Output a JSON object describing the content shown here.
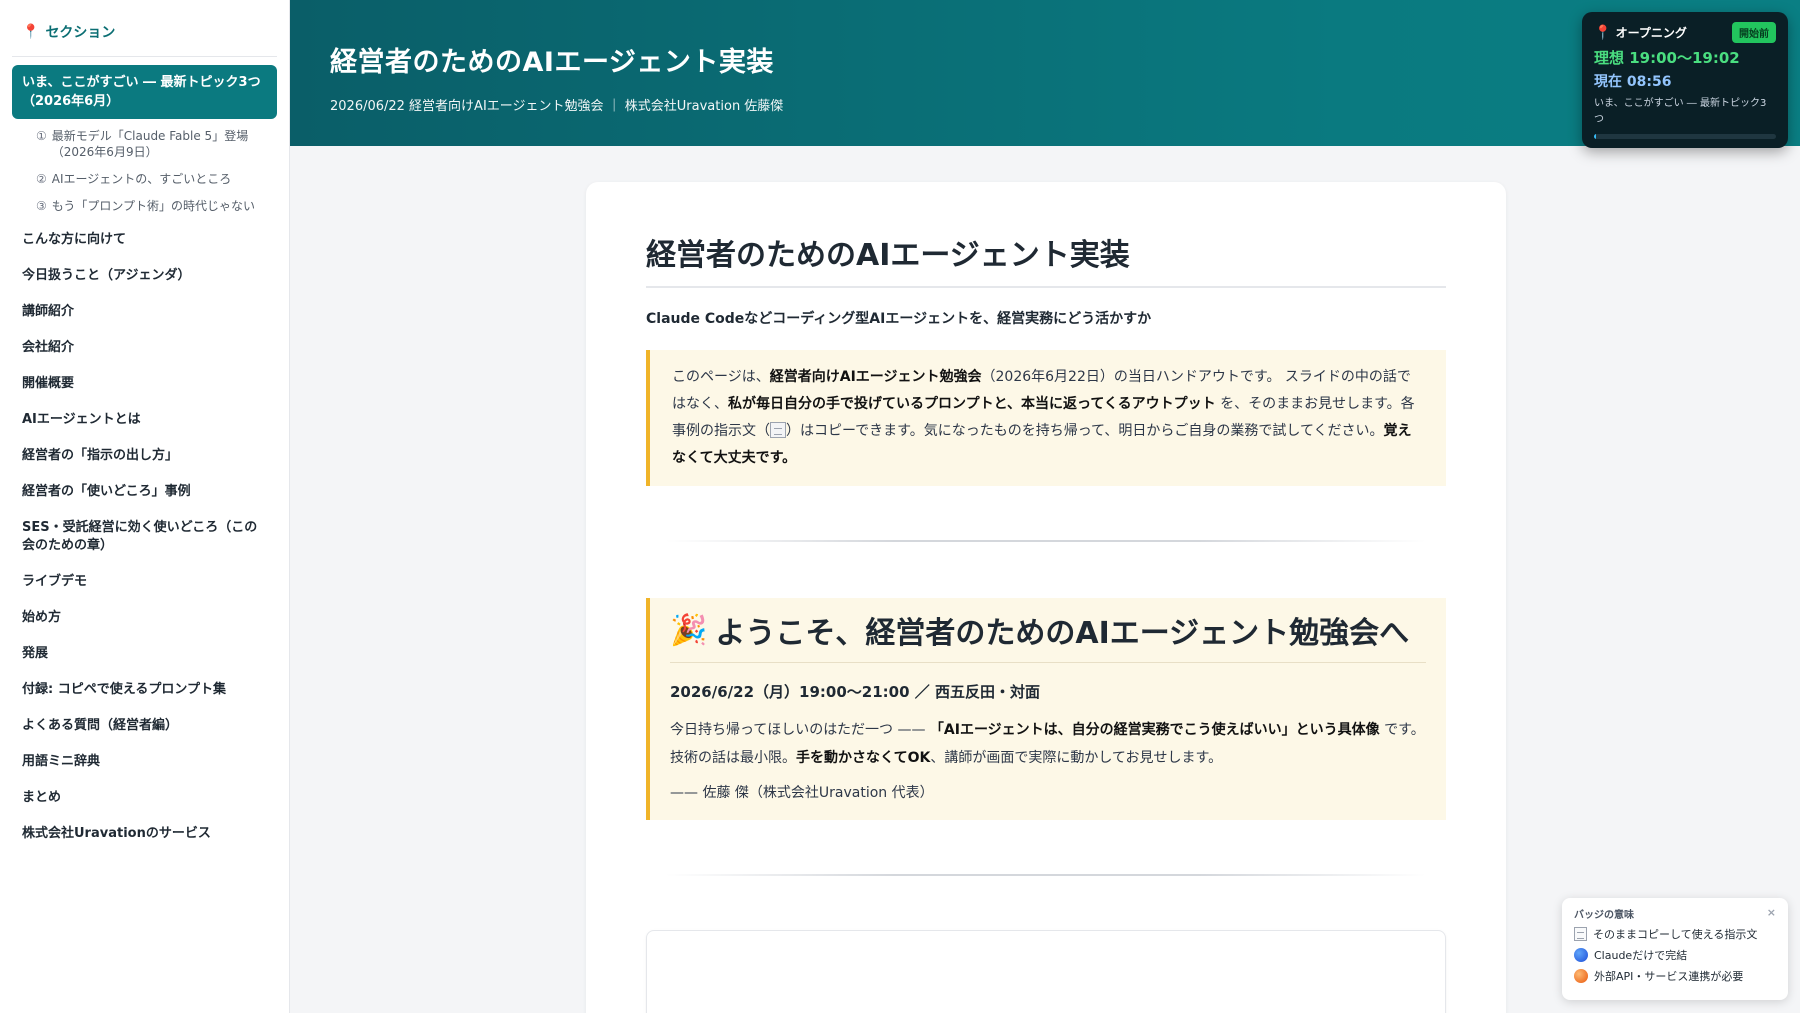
{
  "sidebar": {
    "heading": "セクション",
    "active_item": "いま、ここがすごい ― 最新トピック3つ（2026年6月）",
    "sub_items": [
      {
        "num": "①",
        "label": "最新モデル「Claude Fable 5」登場（2026年6月9日）"
      },
      {
        "num": "②",
        "label": "AIエージェントの、すごいところ"
      },
      {
        "num": "③",
        "label": "もう「プロンプト術」の時代じゃない"
      }
    ],
    "items": [
      "こんな方に向けて",
      "今日扱うこと（アジェンダ）",
      "講師紹介",
      "会社紹介",
      "開催概要",
      "AIエージェントとは",
      "経営者の「指示の出し方」",
      "経営者の「使いどころ」事例",
      "SES・受託経営に効く使いどころ（この会のための章）",
      "ライブデモ",
      "始め方",
      "発展",
      "付録: コピペで使えるプロンプト集",
      "よくある質問（経営者編）",
      "用語ミニ辞典",
      "まとめ",
      "株式会社Uravationのサービス"
    ]
  },
  "header": {
    "title": "経営者のためのAIエージェント実装",
    "subtitle": "2026/06/22 経営者向けAIエージェント勉強会 ｜ 株式会社Uravation 佐藤傑"
  },
  "timer": {
    "section_name": "オープニング",
    "badge": "開始前",
    "planned": "理想 19:00〜19:02",
    "now": "現在 08:56",
    "topic": "いま、ここがすごい ― 最新トピック3つ",
    "progress": 0.01
  },
  "main": {
    "title": "経営者のためのAIエージェント実装",
    "lead": "Claude Codeなどコーディング型AIエージェントを、経営実務にどう活かすか",
    "note": {
      "p1": "このページは、",
      "b1": "経営者向けAIエージェント勉強会",
      "p2": "（2026年6月22日）の当日ハンドアウトです。 スライドの中の話ではなく、",
      "b2": "私が毎日自分の手で投げているプロンプトと、本当に返ってくるアウトプット",
      "p3": " を、そのままお見せします。各事例の指示文（",
      "p4": "）はコピーできます。気になったものを持ち帰って、明日からご自身の業務で試してください。",
      "b3": "覚えなくて大丈夫です。"
    },
    "welcome": {
      "emoji": "🎉",
      "title": "ようこそ、経営者のためのAIエージェント勉強会へ",
      "date": "2026/6/22（月）19:00〜21:00 ／ 西五反田・対面",
      "p1": "今日持ち帰ってほしいのはただ一つ —— ",
      "b1": "「AIエージェントは、自分の経営実務でこう使えばいい」という具体像",
      "p2": " です。技術の話は最小限。",
      "b2": "手を動かさなくてOK",
      "p3": "、講師が画面で実際に動かしてお見せします。",
      "sign": "—— 佐藤 傑（株式会社Uravation 代表）"
    }
  },
  "legend": {
    "title": "バッジの意味",
    "close": "×",
    "rows": [
      {
        "icon": "memo-icon",
        "label": "そのままコピーして使える指示文"
      },
      {
        "icon": "blue-circle-icon",
        "label": "Claudeだけで完結"
      },
      {
        "icon": "orange-circle-icon",
        "label": "外部API・サービス連携が必要"
      }
    ]
  }
}
